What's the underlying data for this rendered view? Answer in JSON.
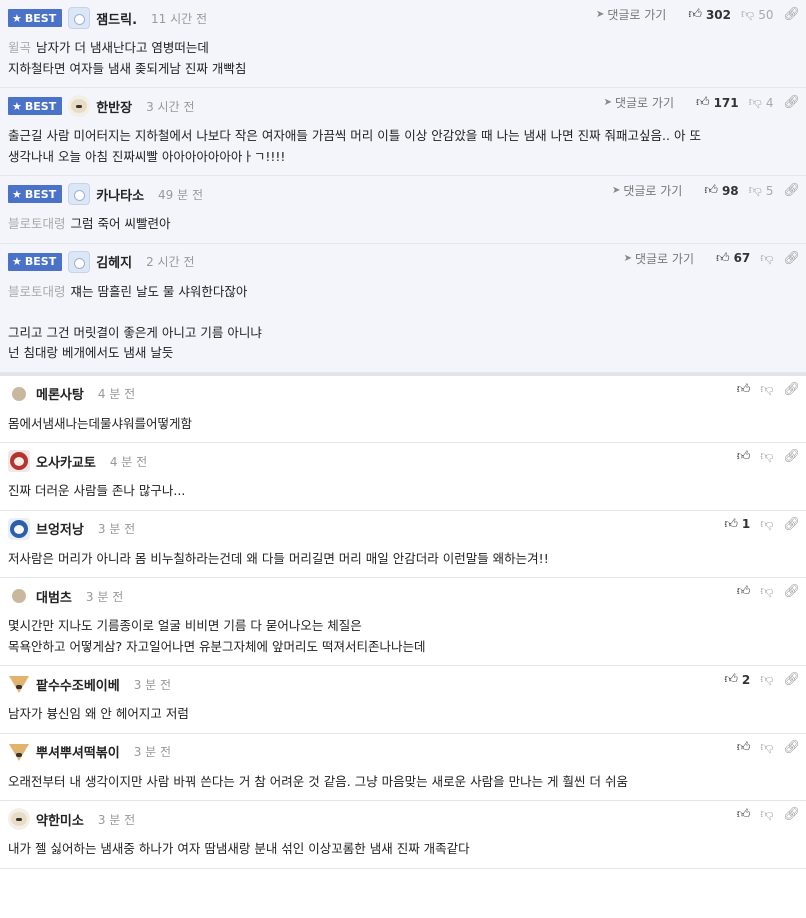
{
  "labels": {
    "best": "BEST",
    "reply": "댓글로 가기"
  },
  "comments": [
    {
      "author": "잼드릭.",
      "time": "11 시간 전",
      "best": true,
      "avatar": "face",
      "up": "302",
      "down": "50",
      "quote": "윌곡",
      "lines": [
        "남자가 더 냄새난다고 염병떠는데",
        "지하철타면 여자들 냄새 좆되게남 진짜 개빡침"
      ]
    },
    {
      "author": "한반장",
      "time": "3 시간 전",
      "best": true,
      "avatar": "dog",
      "up": "171",
      "down": "4",
      "quote": "",
      "lines": [
        "출근길 사람 미어터지는 지하철에서 나보다 작은 여자애들 가끔씩 머리 이틀 이상 안감았을 때 나는 냄새 나면 진짜 줘패고싶음.. 아 또",
        "생각나내 오늘 아침 진짜씨빨 아아아아아아아ㅏㄱ!!!!"
      ]
    },
    {
      "author": "카나타소",
      "time": "49 분 전",
      "best": true,
      "avatar": "face",
      "up": "98",
      "down": "5",
      "quote": "블로토대령",
      "lines": [
        "그럼 죽어 씨빨련아"
      ]
    },
    {
      "author": "김헤지",
      "time": "2 시간 전",
      "best": true,
      "avatar": "face",
      "up": "67",
      "down": "",
      "quote": "블로토대령",
      "lines": [
        "쟤는 땀흘린 날도 물 샤워한다잖아",
        "",
        "그리고 그건 머릿결이 좋은게 아니고 기름 아니냐",
        "넌 침대랑 베개에서도 냄새 날듯"
      ]
    },
    {
      "author": "메론사탕",
      "time": "4 분 전",
      "best": false,
      "avatar": "ball",
      "up": "",
      "down": "",
      "quote": "",
      "lines": [
        "몸에서냄새나는데물샤워를어떻게함"
      ]
    },
    {
      "author": "오사카교토",
      "time": "4 분 전",
      "best": false,
      "avatar": "red",
      "up": "",
      "down": "",
      "quote": "",
      "lines": [
        "진짜 더러운 사람들 존나 많구나..."
      ]
    },
    {
      "author": "브엉저낭",
      "time": "3 분 전",
      "best": false,
      "avatar": "blue",
      "up": "1",
      "down": "",
      "quote": "",
      "lines": [
        "저사람은 머리가 아니라 몸 비누칠하라는건데 왜 다들 머리길면 머리 매일 안감더라 이런말들 왜하는겨!!"
      ]
    },
    {
      "author": "대범츠",
      "time": "3 분 전",
      "best": false,
      "avatar": "ball",
      "up": "",
      "down": "",
      "quote": "",
      "lines": [
        "몇시간만 지나도 기름종이로 얼굴 비비면 기름 다 묻어나오는 체질은",
        "목욕안하고 어떻게삼? 자고일어나면 유분그자체에 앞머리도 떡져서티존나나는데"
      ]
    },
    {
      "author": "팥수수조베이베",
      "time": "3 분 전",
      "best": false,
      "avatar": "fox",
      "up": "2",
      "down": "",
      "quote": "",
      "lines": [
        "남자가 븅신임 왜 안 헤어지고 저럼"
      ]
    },
    {
      "author": "뿌셔뿌셔떡볶이",
      "time": "3 분 전",
      "best": false,
      "avatar": "fox",
      "up": "",
      "down": "",
      "quote": "",
      "lines": [
        "오래전부터 내 생각이지만 사람 바꿔 쓴다는 거 참 어려운 것 같음. 그냥 마음맞는 새로운 사람을 만나는 게 훨씬 더 쉬움"
      ]
    },
    {
      "author": "약한미소",
      "time": "3 분 전",
      "best": false,
      "avatar": "dog",
      "up": "",
      "down": "",
      "quote": "",
      "lines": [
        "내가 젤 싫어하는 냄새중 하나가 여자 땀냄새랑 분내 섞인 이상꼬롬한 냄새 진짜 개족같다"
      ]
    }
  ]
}
